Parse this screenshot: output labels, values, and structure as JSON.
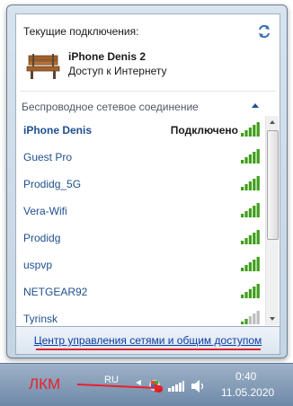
{
  "flyout": {
    "header_title": "Текущие подключения:",
    "current_connection": {
      "name": "iPhone Denis  2",
      "status": "Доступ к Интернету"
    },
    "section_title": "Беспроводное сетевое соединение",
    "networks": [
      {
        "name": "iPhone Denis",
        "status": "Подключено",
        "connected": true
      },
      {
        "name": "Guest Pro",
        "status": "",
        "connected": false
      },
      {
        "name": "Prodidg_5G",
        "status": "",
        "connected": false
      },
      {
        "name": "Vera-Wifi",
        "status": "",
        "connected": false
      },
      {
        "name": "Prodidg",
        "status": "",
        "connected": false
      },
      {
        "name": "uspvp",
        "status": "",
        "connected": false
      },
      {
        "name": "NETGEAR92",
        "status": "",
        "connected": false
      },
      {
        "name": "Tyrinsk",
        "status": "",
        "connected": false
      }
    ],
    "footer_link": "Центр управления сетями и общим доступом"
  },
  "taskbar": {
    "language": "RU",
    "time": "0:40",
    "date": "11.05.2020",
    "icons": [
      "flag-icon",
      "network-icon",
      "speaker-icon"
    ]
  },
  "annotation": {
    "text": "ЛКМ"
  },
  "colors": {
    "link": "#0c3ca4",
    "signal_green": "#3f9e1a",
    "annotation_red": "#e8202a"
  }
}
